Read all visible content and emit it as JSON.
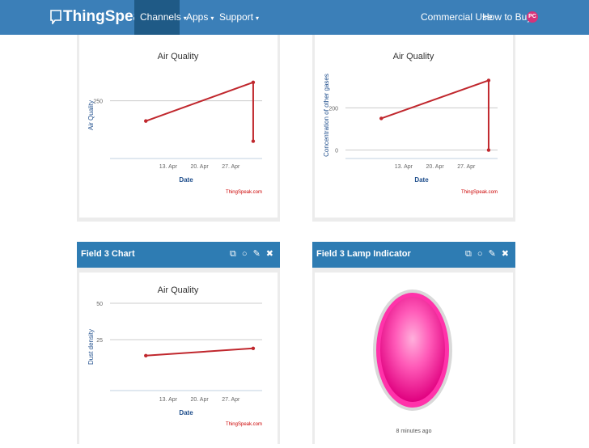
{
  "nav": {
    "brand": "ThingSpeak",
    "trademark": "TM",
    "items": [
      {
        "label": "Channels",
        "caret": "▾",
        "active": true
      },
      {
        "label": "Apps",
        "caret": "▾"
      },
      {
        "label": "Support",
        "caret": "▾"
      }
    ],
    "right_items": [
      "Commercial Use",
      "How to Buy"
    ],
    "avatar_initials": "PC"
  },
  "panels": {
    "p1": {
      "title": ""
    },
    "p2": {
      "title": ""
    },
    "p3": {
      "title": "Field 3 Chart",
      "icons": [
        "external-link-icon",
        "comment-icon",
        "edit-pencil-icon",
        "close-icon"
      ]
    },
    "p4": {
      "title": "Field 3 Lamp Indicator",
      "icons": [
        "external-link-icon",
        "comment-icon",
        "edit-pencil-icon",
        "close-icon"
      ],
      "lamp_color": "#ff33aa",
      "time_ago": "8 minutes ago"
    }
  },
  "credit": "ThingSpeak.com",
  "chart_data": [
    {
      "type": "line",
      "title": "Air Quality",
      "xlabel": "Date",
      "ylabel": "Air Quality",
      "x_ticks": [
        "13. Apr",
        "20. Apr",
        "27. Apr"
      ],
      "y_ticks": [
        250
      ],
      "series": [
        {
          "color": "#c0272d",
          "points": [
            [
              "Apr 8",
              215
            ],
            [
              "May 2",
              282
            ],
            [
              "May 2",
              180
            ]
          ]
        }
      ]
    },
    {
      "type": "line",
      "title": "Air Quality",
      "xlabel": "Date",
      "ylabel": "Concentration of other gases",
      "x_ticks": [
        "13. Apr",
        "20. Apr",
        "27. Apr"
      ],
      "y_ticks": [
        0,
        200
      ],
      "series": [
        {
          "color": "#c0272d",
          "points": [
            [
              "Apr 8",
              150
            ],
            [
              "May 2",
              330
            ],
            [
              "May 2",
              0
            ]
          ]
        }
      ]
    },
    {
      "type": "line",
      "title": "Air Quality",
      "xlabel": "Date",
      "ylabel": "Dust density",
      "x_ticks": [
        "13. Apr",
        "20. Apr",
        "27. Apr"
      ],
      "y_ticks": [
        25,
        50
      ],
      "series": [
        {
          "color": "#c0272d",
          "points": [
            [
              "Apr 8",
              14
            ],
            [
              "May 2",
              19
            ]
          ]
        }
      ]
    }
  ],
  "colors": {
    "nav": "#3b7fb8",
    "nav_active": "#1f5a86",
    "panel_header": "#2e7cb3",
    "series": "#c0272d",
    "axis_text": "#1f4e8c"
  }
}
